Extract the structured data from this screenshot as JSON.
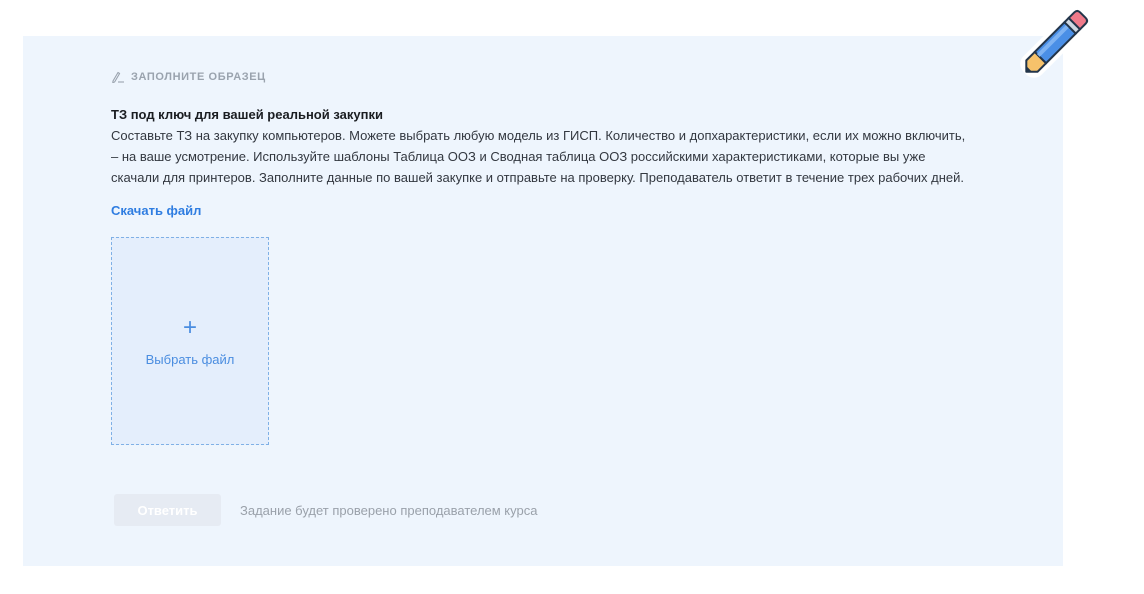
{
  "assignment": {
    "section_label": "ЗАПОЛНИТЕ ОБРАЗЕЦ",
    "section_icon": "pencil-underline-icon",
    "title": "ТЗ под ключ для вашей реальной закупки",
    "description": "Составьте ТЗ на закупку компьютеров. Можете выбрать любую модель из ГИСП. Количество и допхарактеристики, если их можно включить, – на ваше усмотрение. Используйте шаблоны Таблица ООЗ и Сводная таблица ООЗ российскими характеристиками, которые вы уже скачали для принтеров. Заполните данные по вашей закупке и отправьте на проверку. Преподаватель ответит в течение трех рабочих дней.",
    "download_link": "Скачать файл"
  },
  "upload": {
    "plus": "+",
    "label": "Выбрать файл"
  },
  "footer": {
    "submit_label": "Ответить",
    "note": "Задание будет проверено преподавателем курса"
  },
  "decor": {
    "corner_icon": "pencil-icon"
  },
  "colors": {
    "card_background": "#eef5fd",
    "link": "#2f7de1",
    "upload_accent": "#4a8de0"
  }
}
